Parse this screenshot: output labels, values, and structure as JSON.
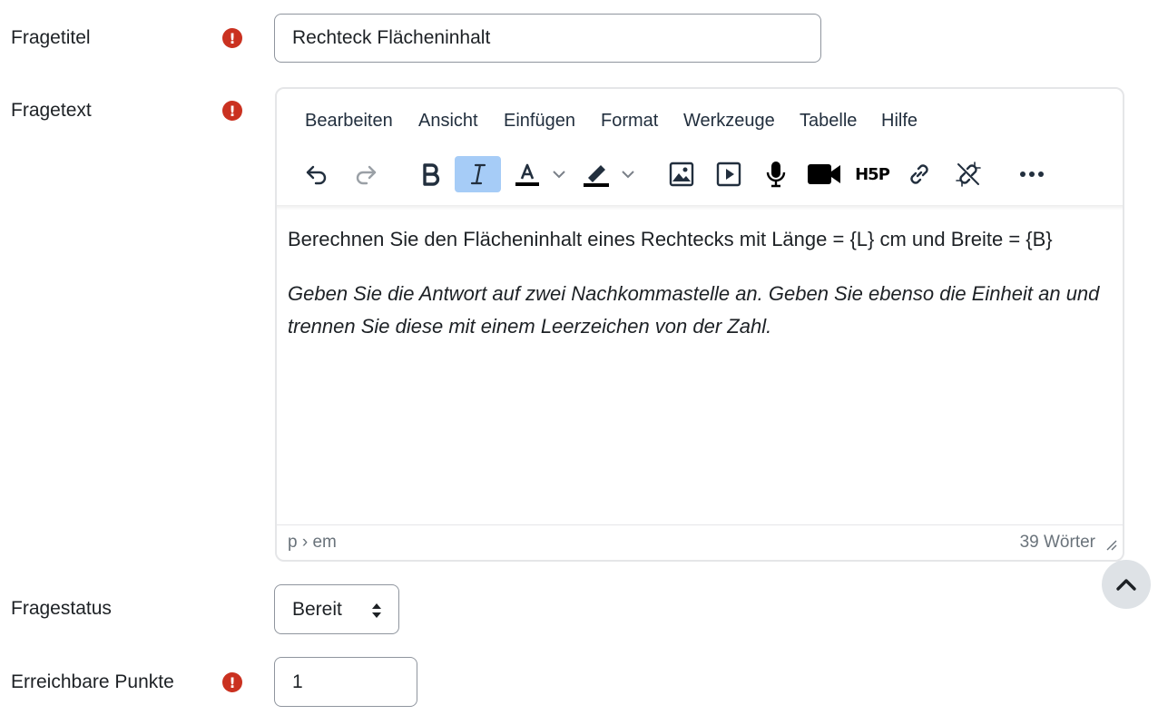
{
  "fields": {
    "title": {
      "label": "Fragetitel",
      "value": "Rechteck Flächeninhalt"
    },
    "text": {
      "label": "Fragetext"
    },
    "status": {
      "label": "Fragestatus",
      "value": "Bereit"
    },
    "points": {
      "label": "Erreichbare Punkte",
      "value": "1"
    }
  },
  "required_mark": "!",
  "editor": {
    "menu": [
      "Bearbeiten",
      "Ansicht",
      "Einfügen",
      "Format",
      "Werkzeuge",
      "Tabelle",
      "Hilfe"
    ],
    "toolbar": [
      "undo-icon",
      "redo-icon",
      "bold-icon",
      "italic-icon",
      "text-color-icon",
      "highlight-icon",
      "image-icon",
      "media-icon",
      "microphone-icon",
      "video-camera-icon",
      "h5p-icon",
      "link-icon",
      "unlink-icon",
      "more-icon"
    ],
    "h5p_label": "H5P",
    "content": {
      "line1": "Berechnen Sie den Flächeninhalt eines Rechtecks mit Länge = {L} cm und Breite = {B}",
      "line2": "Geben Sie die Antwort auf zwei Nachkommastelle an. Geben Sie ebenso die Einheit an und trennen Sie diese mit einem Leerzeichen von der Zahl."
    },
    "status_path": "p › em",
    "word_count": "39 Wörter"
  },
  "colors": {
    "required": "#ca3120",
    "active_button": "#a6ccf7",
    "border": "#8f959e"
  }
}
